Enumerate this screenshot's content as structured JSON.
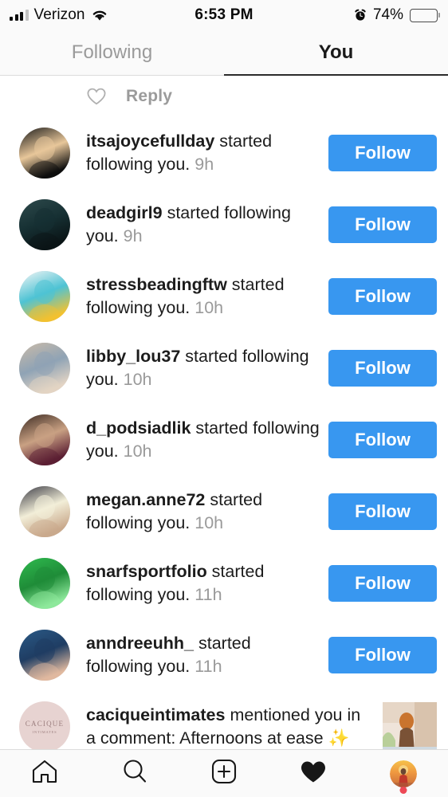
{
  "status_bar": {
    "carrier": "Verizon",
    "time": "6:53 PM",
    "battery_percent": "74%",
    "signal_bars_filled": 3,
    "signal_bars_total": 4,
    "wifi_icon": "wifi-icon",
    "alarm_icon": "alarm-clock-icon",
    "battery_icon": "battery-icon"
  },
  "tabs": [
    {
      "label": "Following",
      "active": false
    },
    {
      "label": "You",
      "active": true
    }
  ],
  "reply_row": {
    "heart_icon": "heart-outline-icon",
    "label": "Reply"
  },
  "notifications": [
    {
      "username": "itsajoycefullday",
      "action": " started following you. ",
      "time": "9h",
      "button": "Follow",
      "avatar_colors": [
        "#1a1a1a",
        "#e8c79a",
        "#0d0d0d"
      ]
    },
    {
      "username": "deadgirl9",
      "action": " started following you. ",
      "time": "9h",
      "button": "Follow",
      "avatar_colors": [
        "#2e4a4c",
        "#163033",
        "#0a1416"
      ]
    },
    {
      "username": "stressbeadingftw",
      "action": " started following you. ",
      "time": "10h",
      "button": "Follow",
      "avatar_colors": [
        "#f6f6f6",
        "#4ec3d4",
        "#f2c230"
      ]
    },
    {
      "username": "libby_lou37",
      "action": " started following you. ",
      "time": "10h",
      "button": "Follow",
      "avatar_colors": [
        "#cbbba8",
        "#8fa3b5",
        "#e3d4c4"
      ]
    },
    {
      "username": "d_podsiadlik",
      "action": " started following you. ",
      "time": "10h",
      "button": "Follow",
      "avatar_colors": [
        "#3b2a22",
        "#c9a183",
        "#5c1f33"
      ]
    },
    {
      "username": "megan.anne72",
      "action": " started following you. ",
      "time": "10h",
      "button": "Follow",
      "avatar_colors": [
        "#3a3a44",
        "#f2eed8",
        "#c9a98c"
      ]
    },
    {
      "username": "snarfsportfolio",
      "action": " started following you. ",
      "time": "11h",
      "button": "Follow",
      "avatar_colors": [
        "#2fbb4f",
        "#1f8c38",
        "#8de89b"
      ]
    },
    {
      "username": "anndreeuhh_",
      "action": " started following you. ",
      "time": "11h",
      "button": "Follow",
      "avatar_colors": [
        "#2b5a86",
        "#1f3d63",
        "#e0b99f"
      ]
    }
  ],
  "mention_notification": {
    "username": "caciqueintimates",
    "text": " mentioned you in a comment: Afternoons at ease ✨",
    "avatar_brand": "CACIQUE",
    "avatar_brand_sub": "INTIMATES",
    "avatar_color": "#e7d3d1",
    "thumbnail_name": "post-thumbnail"
  },
  "bottom_nav": [
    {
      "name": "home-icon",
      "label": "Home",
      "active": false
    },
    {
      "name": "search-icon",
      "label": "Search",
      "active": false
    },
    {
      "name": "add-post-icon",
      "label": "Add",
      "active": false
    },
    {
      "name": "heart-icon",
      "label": "Activity",
      "active": true
    },
    {
      "name": "profile-avatar",
      "label": "Profile",
      "active": false
    }
  ],
  "colors": {
    "accent_blue": "#3897f0",
    "notification_dot": "#ed4956",
    "inactive_gray": "#9a9a9a",
    "text_dark": "#1c1c1c"
  }
}
